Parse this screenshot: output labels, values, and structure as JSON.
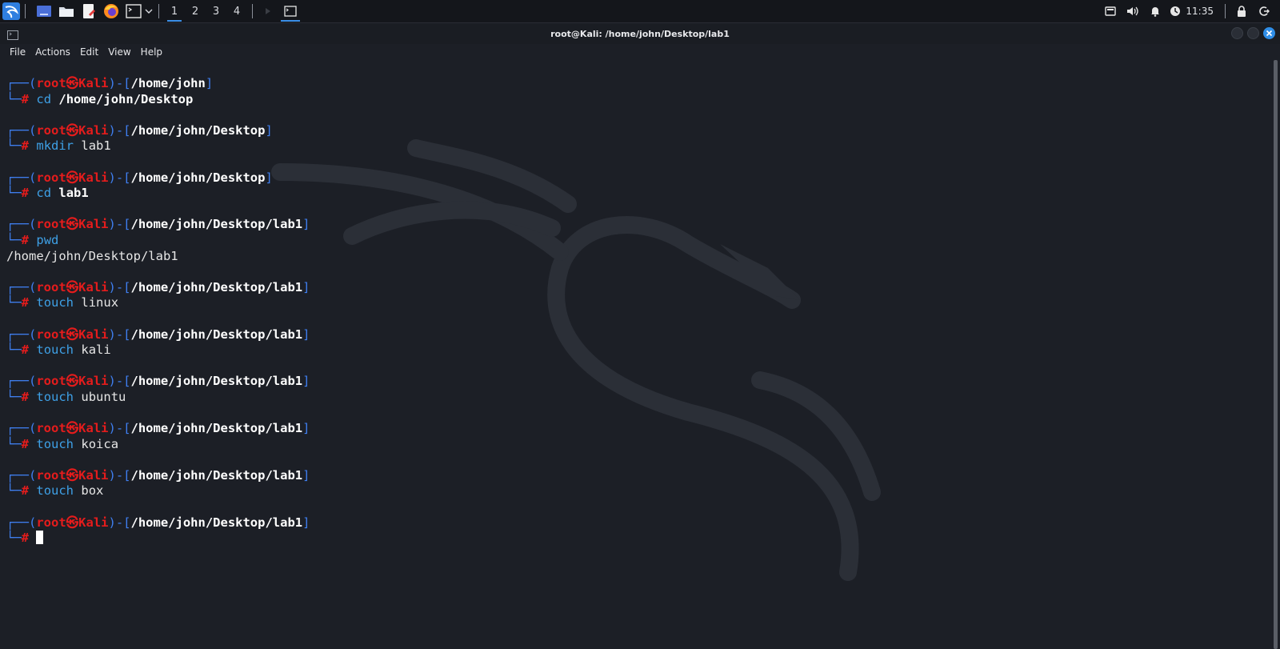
{
  "taskbar": {
    "workspaces": [
      "1",
      "2",
      "3",
      "4"
    ],
    "active_workspace": "1",
    "clock": "11:35"
  },
  "window": {
    "title": "root@Kali: /home/john/Desktop/lab1",
    "menu": [
      "File",
      "Actions",
      "Edit",
      "View",
      "Help"
    ]
  },
  "terminal": {
    "prompt_open": "┌──(",
    "user": "root",
    "at": "㉿",
    "host": "Kali",
    "sep": ")-[",
    "prompt_close": "]",
    "prompt_line2": "└─",
    "hash": "#",
    "blocks": [
      {
        "path": "/home/john",
        "command": "cd",
        "args": "/home/john/Desktop",
        "args_bold": true,
        "output": ""
      },
      {
        "path": "/home/john/Desktop",
        "command": "mkdir",
        "args": "lab1",
        "args_bold": false,
        "output": ""
      },
      {
        "path": "/home/john/Desktop",
        "command": "cd",
        "args": "lab1",
        "args_bold": true,
        "output": ""
      },
      {
        "path": "/home/john/Desktop/lab1",
        "command": "pwd",
        "args": "",
        "args_bold": false,
        "output": "/home/john/Desktop/lab1"
      },
      {
        "path": "/home/john/Desktop/lab1",
        "command": "touch",
        "args": "linux",
        "args_bold": false,
        "output": ""
      },
      {
        "path": "/home/john/Desktop/lab1",
        "command": "touch",
        "args": "kali",
        "args_bold": false,
        "output": ""
      },
      {
        "path": "/home/john/Desktop/lab1",
        "command": "touch",
        "args": "ubuntu",
        "args_bold": false,
        "output": ""
      },
      {
        "path": "/home/john/Desktop/lab1",
        "command": "touch",
        "args": "koica",
        "args_bold": false,
        "output": ""
      },
      {
        "path": "/home/john/Desktop/lab1",
        "command": "touch",
        "args": "box",
        "args_bold": false,
        "output": ""
      },
      {
        "path": "/home/john/Desktop/lab1",
        "command": "",
        "args": "",
        "args_bold": false,
        "output": "",
        "cursor": true
      }
    ]
  },
  "colors": {
    "background": "#1c1f26",
    "prompt_frame": "#3f7ff0",
    "prompt_user": "#e41c1c",
    "command": "#3ea0e6",
    "accent": "#3a8ee6"
  }
}
